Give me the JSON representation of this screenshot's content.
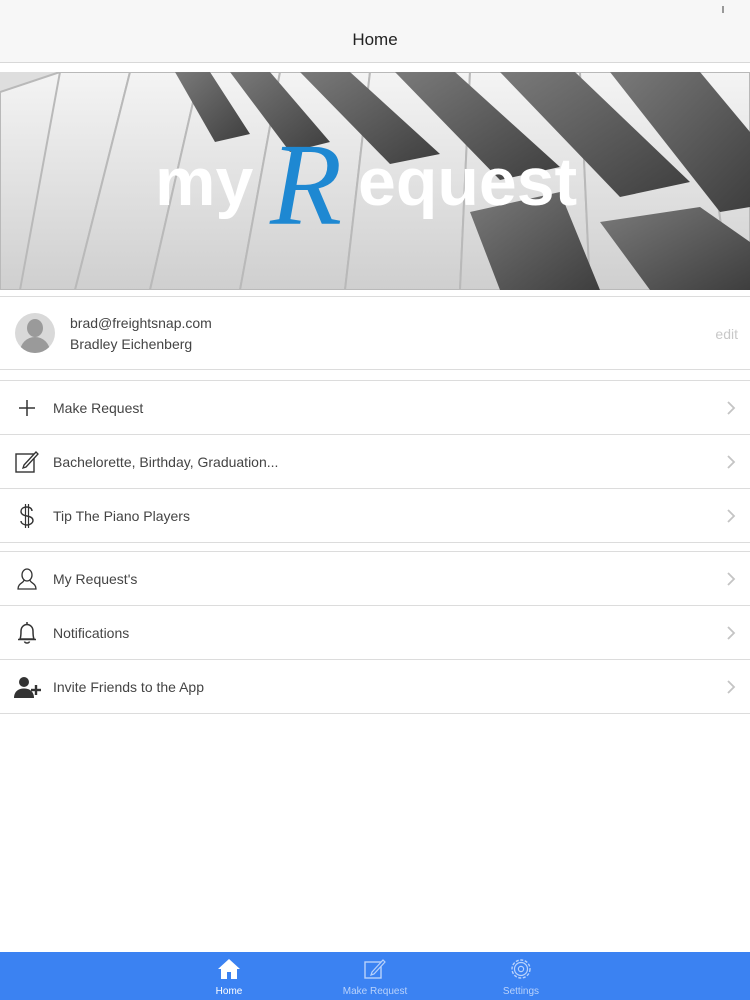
{
  "navbar": {
    "title": "Home"
  },
  "hero": {
    "logo_prefix": "my",
    "logo_initial": "R",
    "logo_suffix": "equest"
  },
  "profile": {
    "email": "brad@freightsnap.com",
    "name": "Bradley Eichenberg",
    "edit_label": "edit"
  },
  "menu_group_1": [
    {
      "label": "Make Request",
      "icon": "plus-icon"
    },
    {
      "label": "Bachelorette, Birthday, Graduation...",
      "icon": "edit-icon"
    },
    {
      "label": "Tip The Piano Players",
      "icon": "dollar-icon"
    }
  ],
  "menu_group_2": [
    {
      "label": "My Request's",
      "icon": "user-icon"
    },
    {
      "label": "Notifications",
      "icon": "bell-icon"
    },
    {
      "label": "Invite Friends to the App",
      "icon": "add-user-icon"
    }
  ],
  "tabbar": {
    "tabs": [
      {
        "label": "Home",
        "icon": "home-icon",
        "active": true
      },
      {
        "label": "Make Request",
        "icon": "edit-icon",
        "active": false
      },
      {
        "label": "Settings",
        "icon": "gear-icon",
        "active": false
      }
    ]
  },
  "colors": {
    "accent": "#3b82f2",
    "logo_blue": "#1e88d2",
    "divider": "#dcdcdc"
  }
}
